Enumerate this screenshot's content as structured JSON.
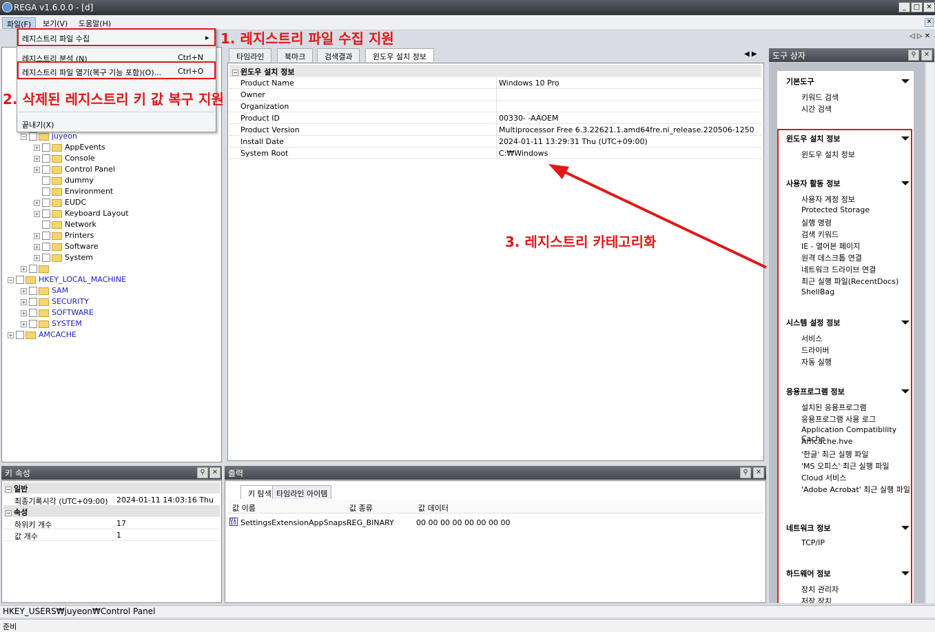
{
  "window": {
    "title": "REGA v1.6.0.0 - [d]"
  },
  "menu": {
    "items": [
      "파일(F)",
      "보기(V)",
      "도움말(H)"
    ]
  },
  "file_menu": {
    "items": [
      {
        "label": "레지스트리 파일 수집",
        "shortcut": "",
        "arrow": "▸"
      },
      {
        "label": "레지스트리 분석 (N)",
        "shortcut": "Ctrl+N"
      },
      {
        "label": "레지스트리 파일 열기(복구 기능 포함)(O)...",
        "shortcut": "Ctrl+O"
      },
      {
        "label": "끝내기(X)",
        "shortcut": ""
      }
    ]
  },
  "annotations": {
    "a1": "1. 레지스트리 파일 수집 지원",
    "a2": "2. 삭제된 레지스트리 키 값 복구 지원",
    "a3": "3. 레지스트리 카테고리화"
  },
  "tree": {
    "nodes": [
      {
        "label": "juyeon",
        "indent": 1,
        "blue": true,
        "exp": "-"
      },
      {
        "label": "AppEvents",
        "indent": 2,
        "exp": "+"
      },
      {
        "label": "Console",
        "indent": 2,
        "exp": "+"
      },
      {
        "label": "Control Panel",
        "indent": 2,
        "exp": "+"
      },
      {
        "label": "dummy",
        "indent": 2,
        "exp": ""
      },
      {
        "label": "Environment",
        "indent": 2,
        "exp": ""
      },
      {
        "label": "EUDC",
        "indent": 2,
        "exp": "+"
      },
      {
        "label": "Keyboard Layout",
        "indent": 2,
        "exp": "+"
      },
      {
        "label": "Network",
        "indent": 2,
        "exp": ""
      },
      {
        "label": "Printers",
        "indent": 2,
        "exp": "+"
      },
      {
        "label": "Software",
        "indent": 2,
        "exp": "+"
      },
      {
        "label": "System",
        "indent": 2,
        "exp": "+"
      },
      {
        "label": "",
        "indent": 1,
        "exp": "+"
      },
      {
        "label": "HKEY_LOCAL_MACHINE",
        "indent": 0,
        "blue": true,
        "exp": "-"
      },
      {
        "label": "SAM",
        "indent": 1,
        "blue": true,
        "exp": "+"
      },
      {
        "label": "SECURITY",
        "indent": 1,
        "blue": true,
        "exp": "+"
      },
      {
        "label": "SOFTWARE",
        "indent": 1,
        "blue": true,
        "exp": "+"
      },
      {
        "label": "SYSTEM",
        "indent": 1,
        "blue": true,
        "exp": "+"
      },
      {
        "label": "AMCACHE",
        "indent": 0,
        "blue": true,
        "exp": "+"
      }
    ]
  },
  "main_tabs": [
    "타임라인",
    "북마크",
    "검색결과",
    "윈도우 설치 정보"
  ],
  "install_info": {
    "section": "윈도우 설치 정보",
    "rows": [
      {
        "k": "Product Name",
        "v": "Windows 10 Pro"
      },
      {
        "k": "Owner",
        "v": ""
      },
      {
        "k": "Organization",
        "v": ""
      },
      {
        "k": "Product ID",
        "v": "00330-                    -AAOEM"
      },
      {
        "k": "Product Version",
        "v": "Multiprocessor Free 6.3.22621.1.amd64fre.ni_release.220506-1250"
      },
      {
        "k": "Install Date",
        "v": "2024-01-11  13:29:31  Thu (UTC+09:00)"
      },
      {
        "k": "System Root",
        "v": "C:₩Windows"
      }
    ]
  },
  "key_props": {
    "title": "키 속성",
    "groups": [
      {
        "name": "일반",
        "rows": [
          {
            "k": "최종기록시각 (UTC+09:00)",
            "v": "2024-01-11  14:03:16  Thu"
          }
        ]
      },
      {
        "name": "속성",
        "rows": [
          {
            "k": "하위키 개수",
            "v": "17"
          },
          {
            "k": "값 개수",
            "v": "1"
          }
        ]
      }
    ]
  },
  "output": {
    "title": "출력",
    "tabs": [
      "키 탐색",
      "타임라인 아이템"
    ],
    "columns": [
      "값 이름",
      "값 종류",
      "값 데이터"
    ],
    "rows": [
      {
        "name": "SettingsExtensionAppSnaps...",
        "type": "REG_BINARY",
        "data": "00 00 00 00 00 00 00 00"
      }
    ]
  },
  "toolbox": {
    "title": "도구 상자",
    "sections": [
      {
        "title": "기본도구",
        "items": [
          "키워드 검색",
          "시간 검색"
        ]
      },
      {
        "title": "윈도우 설치 정보",
        "items": [
          "윈도우 설치 정보"
        ]
      },
      {
        "title": "사용자 활동 정보",
        "items": [
          "사용자 계정 정보",
          "Protected Storage",
          "실행 명령",
          "검색 키워드",
          "IE - 열어본 페이지",
          "원격 데스크톱 연결",
          "네트워크 드라이브 연결",
          "최근 실행 파일(RecentDocs)",
          "ShellBag"
        ]
      },
      {
        "title": "시스템 설정 정보",
        "items": [
          "서비스",
          "드라이버",
          "자동 실행"
        ]
      },
      {
        "title": "응용프로그램 정보",
        "items": [
          "설치된 응용프로그램",
          "응용프로그램 사용 로그",
          "Application Compatibility Cache",
          "Amcache.hve",
          "'한글' 최근 실행 파일",
          "'MS 오피스' 최근 실행 파일",
          "Cloud 서비스",
          "'Adobe Acrobat' 최근 실행 파일"
        ]
      },
      {
        "title": "네트워크 정보",
        "items": [
          "TCP/IP"
        ]
      },
      {
        "title": "하드웨어 정보",
        "items": [
          "장치 관리자",
          "저장 장치"
        ]
      }
    ]
  },
  "statusbar": {
    "path": "HKEY_USERS₩juyeon₩Control Panel",
    "state": "준비"
  },
  "colors": {
    "annotation": "#e01818",
    "tree_blue": "#1a1acc"
  }
}
